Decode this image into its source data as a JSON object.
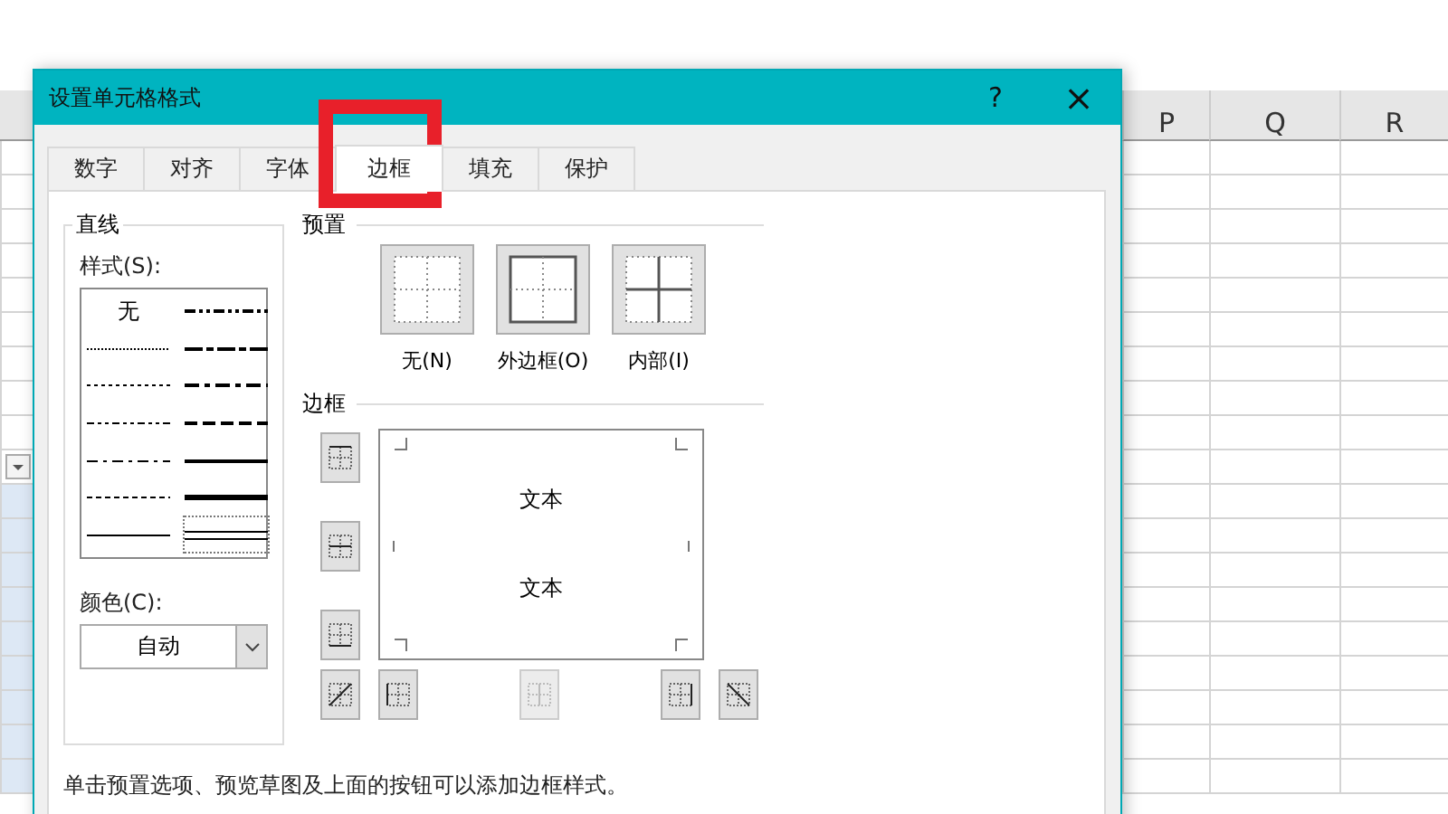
{
  "sheet": {
    "columns": [
      "P",
      "Q",
      "R"
    ]
  },
  "dialog": {
    "title": "设置单元格格式",
    "help": "?",
    "close": "×",
    "tabs": [
      {
        "label": "数字",
        "selected": false
      },
      {
        "label": "对齐",
        "selected": false
      },
      {
        "label": "字体",
        "selected": false
      },
      {
        "label": "边框",
        "selected": true
      },
      {
        "label": "填充",
        "selected": false
      },
      {
        "label": "保护",
        "selected": false
      }
    ],
    "line": {
      "title": "直线",
      "style_label": "样式(S):",
      "styles": [
        {
          "kind": "none",
          "label": "无",
          "selected": false
        },
        {
          "kind": "hair",
          "selected": false
        },
        {
          "kind": "dotted",
          "selected": false
        },
        {
          "kind": "dash-dot-dot",
          "selected": false
        },
        {
          "kind": "dash-dot",
          "selected": false
        },
        {
          "kind": "dashed",
          "selected": false
        },
        {
          "kind": "thin",
          "selected": false
        },
        {
          "kind": "medium-dash-dot-dot",
          "selected": false
        },
        {
          "kind": "slanted-dash-dot",
          "selected": false
        },
        {
          "kind": "medium-dash-dot",
          "selected": false
        },
        {
          "kind": "medium-dashed",
          "selected": false
        },
        {
          "kind": "medium",
          "selected": false
        },
        {
          "kind": "thick",
          "selected": false
        },
        {
          "kind": "double",
          "selected": true
        }
      ],
      "color_label": "颜色(C):",
      "color_value": "自动"
    },
    "presets": {
      "title": "预置",
      "items": [
        {
          "kind": "none",
          "label": "无(N)"
        },
        {
          "kind": "outline",
          "label": "外边框(O)"
        },
        {
          "kind": "inside",
          "label": "内部(I)"
        }
      ]
    },
    "border": {
      "title": "边框",
      "preview_texts": [
        "文本",
        "文本"
      ],
      "side_buttons": [
        {
          "kind": "top",
          "disabled": false
        },
        {
          "kind": "middle",
          "disabled": false
        },
        {
          "kind": "bottom",
          "disabled": false
        }
      ],
      "bottom_buttons": [
        {
          "kind": "diag-up",
          "disabled": false
        },
        {
          "kind": "left",
          "disabled": false
        },
        {
          "kind": "center",
          "disabled": true
        },
        {
          "kind": "right",
          "disabled": false
        },
        {
          "kind": "diag-down",
          "disabled": false
        }
      ]
    },
    "hint": "单击预置选项、预览草图及上面的按钮可以添加边框样式。"
  }
}
